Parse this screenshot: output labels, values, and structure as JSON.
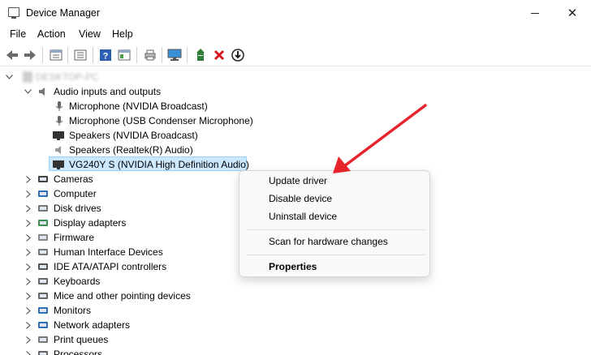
{
  "window": {
    "title": "Device Manager",
    "close_glyph": "✕"
  },
  "menu": [
    "File",
    "Action",
    "View",
    "Help"
  ],
  "toolbar": {
    "icons": [
      "back-icon",
      "forward-icon",
      "tree-view-icon",
      "properties-list-icon",
      "help-icon",
      "panel-icon",
      "print-icon",
      "scan-monitor-icon",
      "update-driver-icon",
      "uninstall-x-icon",
      "download-driver-icon"
    ]
  },
  "tree": {
    "root_label": "DESKTOP-PC",
    "expanded_category": "Audio inputs and outputs",
    "audio_devices": [
      "Microphone (NVIDIA Broadcast)",
      "Microphone (USB Condenser Microphone)",
      "Speakers (NVIDIA Broadcast)",
      "Speakers (Realtek(R) Audio)",
      "VG240Y S (NVIDIA High Definition Audio)"
    ],
    "categories": [
      "Cameras",
      "Computer",
      "Disk drives",
      "Display adapters",
      "Firmware",
      "Human Interface Devices",
      "IDE ATA/ATAPI controllers",
      "Keyboards",
      "Mice and other pointing devices",
      "Monitors",
      "Network adapters",
      "Print queues",
      "Processors"
    ]
  },
  "context_menu": {
    "items": [
      "Update driver",
      "Disable device",
      "Uninstall device"
    ],
    "scan": "Scan for hardware changes",
    "properties": "Properties"
  },
  "colors": {
    "accent_arrow": "#e8242b",
    "selection": "#cce8ff"
  }
}
